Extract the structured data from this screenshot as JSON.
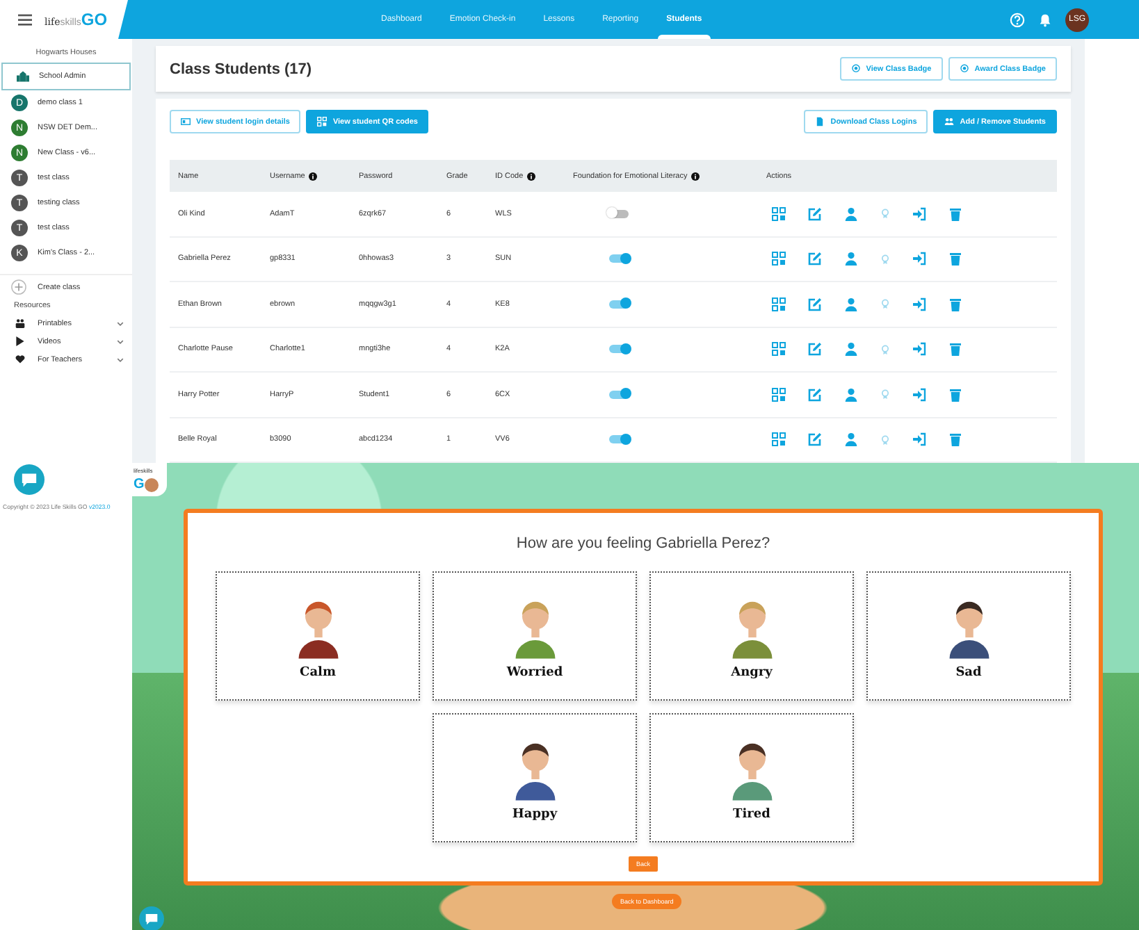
{
  "topbar": {
    "logo": [
      "life",
      "skills",
      "GO"
    ],
    "nav": [
      {
        "label": "Dashboard",
        "selected": false
      },
      {
        "label": "Emotion Check-in",
        "selected": false
      },
      {
        "label": "Lessons",
        "selected": false
      },
      {
        "label": "Reporting",
        "selected": false
      },
      {
        "label": "Students",
        "selected": true
      }
    ],
    "avatar": "LSG"
  },
  "sidebar": {
    "school": "Hogwarts Houses",
    "items": [
      {
        "kind": "admin",
        "label": "School Admin",
        "selected": true
      },
      {
        "kind": "class",
        "initial": "D",
        "label": "demo class 1",
        "color": "#17756b",
        "selected": false
      },
      {
        "kind": "class",
        "initial": "N",
        "label": "NSW DET Dem...",
        "color": "#2e7d32",
        "selected": false
      },
      {
        "kind": "class",
        "initial": "N",
        "label": "New Class - v6...",
        "color": "#2e7d32",
        "selected": false
      },
      {
        "kind": "class",
        "initial": "T",
        "label": "test class",
        "color": "#555555",
        "selected": false
      },
      {
        "kind": "class",
        "initial": "T",
        "label": "testing class",
        "color": "#555555",
        "selected": false
      },
      {
        "kind": "class",
        "initial": "T",
        "label": "test class",
        "color": "#555555",
        "selected": false
      },
      {
        "kind": "class",
        "initial": "K",
        "label": "Kim's Class - 2...",
        "color": "#555555",
        "selected": false
      }
    ],
    "create": "Create class",
    "resources_heading": "Resources",
    "resources": [
      {
        "kind": "printables",
        "label": "Printables"
      },
      {
        "kind": "videos",
        "label": "Videos"
      },
      {
        "kind": "teachers",
        "label": "For Teachers"
      }
    ],
    "copyright": "Copyright © 2023 Life Skills GO",
    "version": "v2023.0"
  },
  "page": {
    "title": "Class Students (17)",
    "header_buttons": [
      "View Class Badge",
      "Award Class Badge"
    ],
    "left_buttons": [
      {
        "label": "View student login details",
        "primary": false
      },
      {
        "label": "View student QR codes",
        "primary": true
      }
    ],
    "right_buttons": [
      {
        "label": "Download Class Logins",
        "primary": false
      },
      {
        "label": "Add / Remove Students",
        "primary": true
      }
    ]
  },
  "table": {
    "columns": [
      {
        "label": "Name"
      },
      {
        "label": "Username",
        "info": true
      },
      {
        "label": "Password"
      },
      {
        "label": "Grade"
      },
      {
        "label": "ID Code",
        "info": true
      },
      {
        "label": "Foundation for Emotional Literacy",
        "info": true
      },
      {
        "label": "Actions"
      }
    ],
    "rows": [
      {
        "cells": [
          "Oli Kind",
          "AdamT",
          "6zqrk67",
          "6",
          "WLS"
        ],
        "foundation_on": false
      },
      {
        "cells": [
          "Gabriella Perez",
          "gp8331",
          "0hhowas3",
          "3",
          "SUN"
        ],
        "foundation_on": true
      },
      {
        "cells": [
          "Ethan Brown",
          "ebrown",
          "mqqgw3g1",
          "4",
          "KE8"
        ],
        "foundation_on": true
      },
      {
        "cells": [
          "Charlotte Pause",
          "Charlotte1",
          "mngti3he",
          "4",
          "K2A"
        ],
        "foundation_on": true
      },
      {
        "cells": [
          "Harry Potter",
          "HarryP",
          "Student1",
          "6",
          "6CX"
        ],
        "foundation_on": true
      },
      {
        "cells": [
          "Belle Royal",
          "b3090",
          "abcd1234",
          "1",
          "VV6"
        ],
        "foundation_on": true
      }
    ]
  },
  "checkin": {
    "mini_logo": [
      "lifeskills",
      "G"
    ],
    "question": "How are you feeling Gabriella Perez?",
    "emotions": [
      {
        "label": "Calm"
      },
      {
        "label": "Worried"
      },
      {
        "label": "Angry"
      },
      {
        "label": "Sad"
      },
      {
        "label": "Happy"
      },
      {
        "label": "Tired"
      }
    ],
    "back": "Back",
    "dashboard": "Back to Dashboard"
  }
}
